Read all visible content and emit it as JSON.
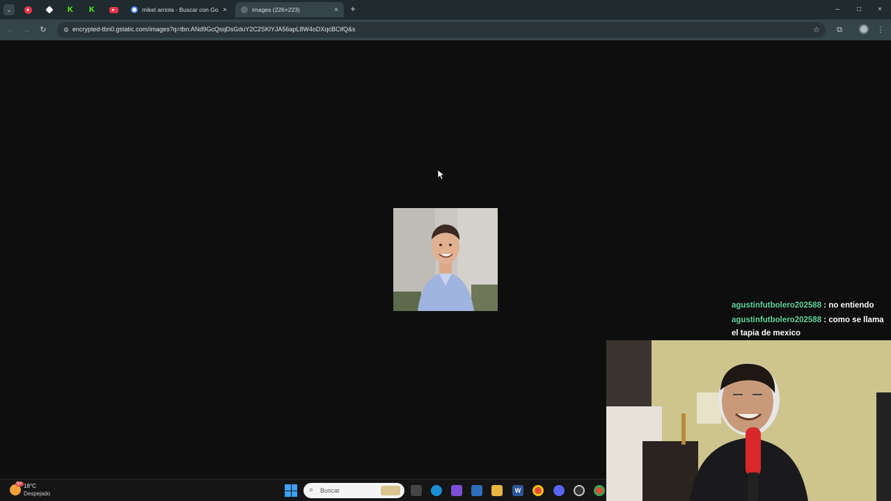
{
  "browser": {
    "tabs": [
      {
        "title": "mikel arriola - Buscar con Goog",
        "close": "×"
      },
      {
        "title": "images (226×223)",
        "close": "×"
      }
    ],
    "new_tab_label": "+",
    "url": "encrypted-tbn0.gstatic.com/images?q=tbn:ANd9GcQsqDsGduY2C2SKlYJA56apL8W4oDXqcBCifQ&s",
    "window": {
      "minimize": "–",
      "maximize": "□",
      "close": "×"
    },
    "nav": {
      "back": "←",
      "forward": "→",
      "reload": "↻"
    }
  },
  "icons": {
    "tab_search": "chevron-down-icon",
    "star": "star-icon",
    "extensions": "puzzle-icon",
    "menu": "more-vert-icon"
  },
  "chat": {
    "messages": [
      {
        "user": "agustinfutbolero202588",
        "text": " : no entiendo"
      },
      {
        "user": "agustinfutbolero202588",
        "text": " : como se llama"
      }
    ],
    "continuation": "el tapia de mexico",
    "user_color": "#62d6a2"
  },
  "taskbar": {
    "temperature": "18°C",
    "condition": "Despejado",
    "weather_badge": "9+",
    "search_placeholder": "Buscar",
    "word_label": "W"
  },
  "colors": {
    "tabstrip": "#1f2b2f",
    "toolbar": "#34444a",
    "page_background": "#0e0e0e"
  }
}
